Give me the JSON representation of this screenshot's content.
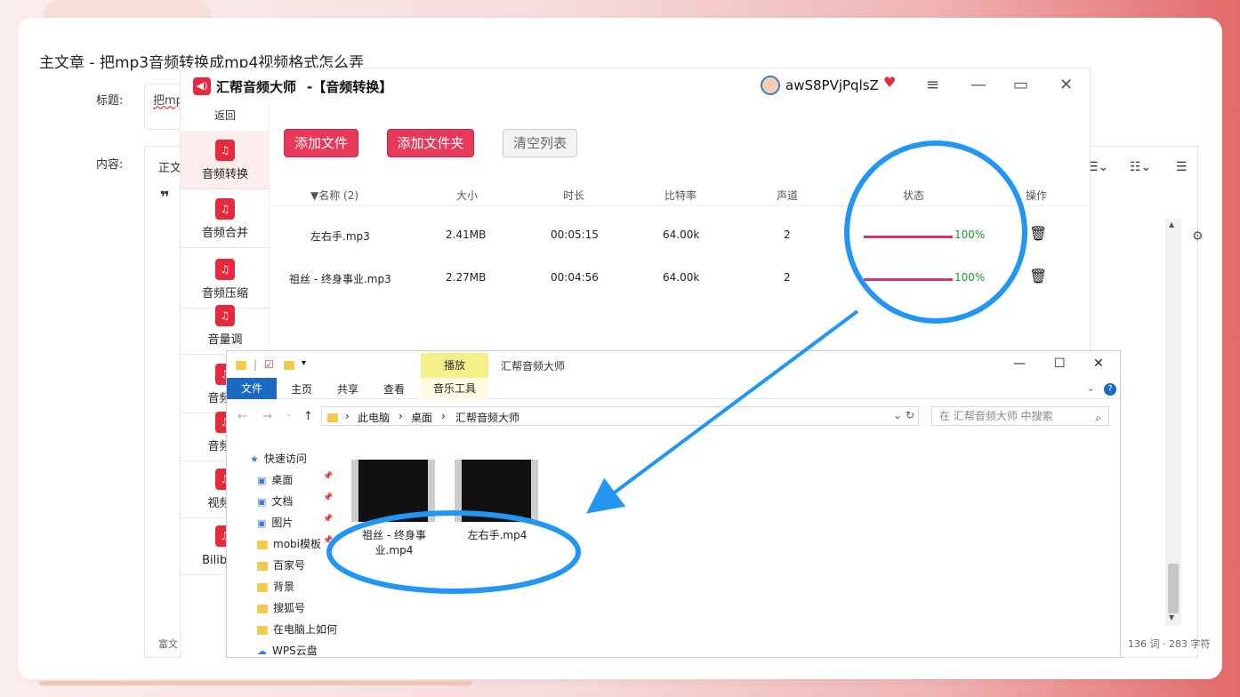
{
  "page": {
    "article_title": "主文章 - 把mp3音频转换成mp4视频格式怎么弄"
  },
  "editor": {
    "title_label": "标题:",
    "title_value": "把mp",
    "content_label": "内容:",
    "toolbar_text": "正文",
    "quote_icon": "quote-icon",
    "status_left": "富文",
    "status_right": "136 词 · 283 字符"
  },
  "app": {
    "name": "汇帮音频大师",
    "subtitle": "-【音频转换】",
    "username": "awS8PVjPqlsZ",
    "back_label": "返回",
    "sidebar": [
      {
        "label": "音频转换",
        "icon": "convert-icon",
        "active": true
      },
      {
        "label": "音频合并",
        "icon": "merge-icon"
      },
      {
        "label": "音频压缩",
        "icon": "compress-icon"
      },
      {
        "label": "音量调",
        "icon": "volume-icon"
      },
      {
        "label": "音频录",
        "icon": "record-icon"
      },
      {
        "label": "音频截",
        "icon": "cut-icon"
      },
      {
        "label": "视频转",
        "icon": "video-icon"
      },
      {
        "label": "Bilibili转",
        "icon": "bilibili-icon"
      }
    ],
    "buttons": {
      "add_file": "添加文件",
      "add_folder": "添加文件夹",
      "clear_list": "清空列表"
    },
    "columns": [
      "▼名称 (2)",
      "大小",
      "时长",
      "比特率",
      "声道",
      "状态",
      "操作"
    ],
    "rows": [
      {
        "name": "左右手.mp3",
        "size": "2.41MB",
        "duration": "00:05:15",
        "bitrate": "64.00k",
        "channels": "2",
        "progress": "100%",
        "progress_value": 1.0
      },
      {
        "name": "祖丝 - 终身事业.mp3",
        "size": "2.27MB",
        "duration": "00:04:56",
        "bitrate": "64.00k",
        "channels": "2",
        "progress": "100%",
        "progress_value": 1.0
      }
    ]
  },
  "explorer": {
    "title": "汇帮音频大师",
    "play_tab": "播放",
    "ribbon_tabs": [
      "文件",
      "主页",
      "共享",
      "查看",
      "音乐工具"
    ],
    "path": [
      "此电脑",
      "桌面",
      "汇帮音频大师"
    ],
    "search_placeholder": "在 汇帮音频大师 中搜索",
    "tree": [
      {
        "label": "快速访问",
        "icon": "star-icon"
      },
      {
        "label": "桌面",
        "icon": "desktop-icon",
        "pinned": true
      },
      {
        "label": "文档",
        "icon": "document-icon",
        "pinned": true
      },
      {
        "label": "图片",
        "icon": "picture-icon",
        "pinned": true
      },
      {
        "label": "mobi模板",
        "icon": "folder-icon",
        "pinned": true
      },
      {
        "label": "百家号",
        "icon": "folder-icon"
      },
      {
        "label": "背景",
        "icon": "folder-icon"
      },
      {
        "label": "搜狐号",
        "icon": "folder-icon"
      },
      {
        "label": "在电脑上如何",
        "icon": "folder-icon"
      },
      {
        "label": "WPS云盘",
        "icon": "cloud-icon"
      }
    ],
    "files": [
      {
        "name": "祖丝 - 终身事业.mp4"
      },
      {
        "name": "左右手.mp4"
      }
    ]
  },
  "annotation": {
    "color": "#2196f3"
  }
}
